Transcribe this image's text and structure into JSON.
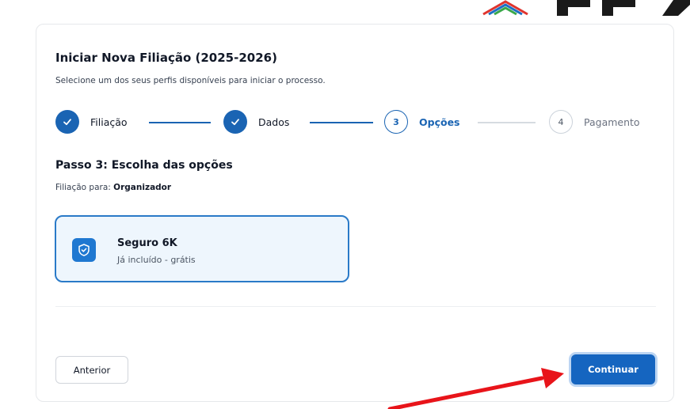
{
  "header": {
    "title": "Iniciar Nova Filiação (2025-2026)",
    "subtitle": "Selecione um dos seus perfis disponíveis para iniciar o processo."
  },
  "stepper": {
    "steps": [
      {
        "number": "1",
        "label": "Filiação",
        "state": "done"
      },
      {
        "number": "2",
        "label": "Dados",
        "state": "done"
      },
      {
        "number": "3",
        "label": "Opções",
        "state": "active"
      },
      {
        "number": "4",
        "label": "Pagamento",
        "state": "todo"
      }
    ]
  },
  "step": {
    "title": "Passo 3: Escolha das opções",
    "profile_prefix": "Filiação para: ",
    "profile_name": "Organizador"
  },
  "option": {
    "icon": "shield-check-icon",
    "title": "Seguro 6K",
    "subtitle": "Já incluído - grátis",
    "selected": true
  },
  "actions": {
    "previous_label": "Anterior",
    "continue_label": "Continuar"
  },
  "colors": {
    "primary": "#1a64b3",
    "option_bg": "#eef6fd",
    "option_border": "#2a7ac8",
    "annotation_arrow": "#e8141a"
  }
}
